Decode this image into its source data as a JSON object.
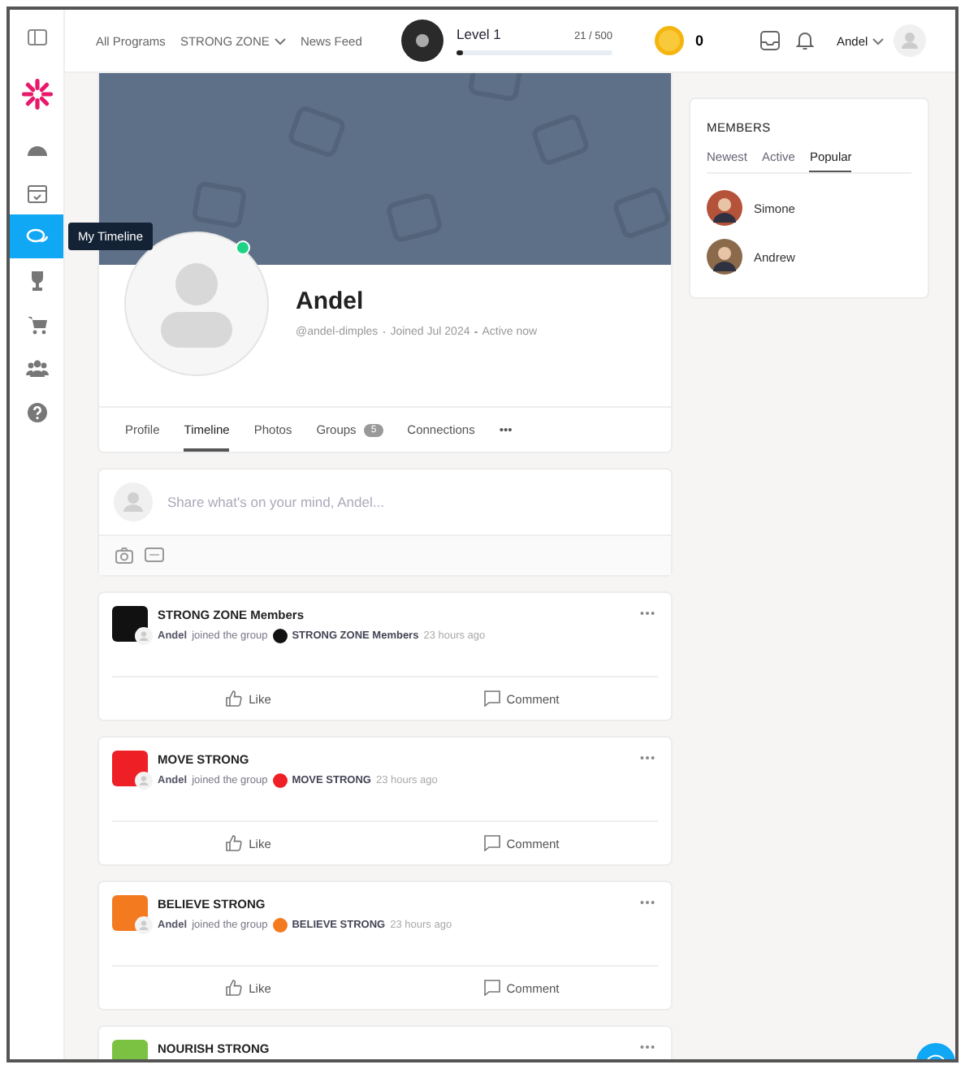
{
  "header": {
    "nav": [
      {
        "label": "All Programs",
        "dropdown": false
      },
      {
        "label": "STRONG ZONE",
        "dropdown": true
      },
      {
        "label": "News Feed",
        "dropdown": false
      }
    ],
    "level": {
      "title": "Level 1",
      "reading": "21 / 500",
      "level": 0.042
    },
    "coins": "0",
    "user": "Andel"
  },
  "sidebar": {
    "items": [
      {
        "selected": false
      },
      {
        "selected": false
      },
      {
        "selected": true
      },
      {
        "selected": false
      },
      {
        "selected": false
      },
      {
        "selected": false
      },
      {
        "selected": false
      }
    ],
    "tooltip": "My Timeline"
  },
  "profile": {
    "name": "Andel",
    "online": true,
    "handle": "@andel-dimples",
    "joined": "Joined Jul 2024",
    "activity": "Active now",
    "tabs": [
      {
        "label": "Profile",
        "selected": false
      },
      {
        "label": "Timeline",
        "selected": true
      },
      {
        "label": "Photos",
        "selected": false
      },
      {
        "label": "Groups",
        "count": "5",
        "selected": false
      },
      {
        "label": "Connections",
        "selected": false
      },
      {
        "label": "•••",
        "selected": false
      }
    ]
  },
  "composer": {
    "placeholder": "Share what's on your mind, Andel..."
  },
  "posts": [
    {
      "title": "STRONG ZONE Members",
      "actor": "Andel",
      "action": "joined the group",
      "group": "STRONG ZONE Members",
      "time": "23 hours ago",
      "color": "#111111",
      "like": "Like",
      "comment": "Comment"
    },
    {
      "title": "MOVE STRONG",
      "actor": "Andel",
      "action": "joined the group",
      "group": "MOVE STRONG",
      "time": "23 hours ago",
      "color": "#ee2026",
      "like": "Like",
      "comment": "Comment"
    },
    {
      "title": "BELIEVE STRONG",
      "actor": "Andel",
      "action": "joined the group",
      "group": "BELIEVE STRONG",
      "time": "23 hours ago",
      "color": "#f47a20",
      "like": "Like",
      "comment": "Comment"
    },
    {
      "title": "NOURISH STRONG",
      "color": "#7cc242"
    }
  ],
  "members": {
    "title": "MEMBERS",
    "tabs": [
      {
        "label": "Newest",
        "selected": false
      },
      {
        "label": "Active",
        "selected": false
      },
      {
        "label": "Popular",
        "selected": true
      }
    ],
    "list": [
      {
        "name": "Simone",
        "color": "#b5533a"
      },
      {
        "name": "Andrew",
        "color": "#8a6a4a"
      }
    ]
  }
}
